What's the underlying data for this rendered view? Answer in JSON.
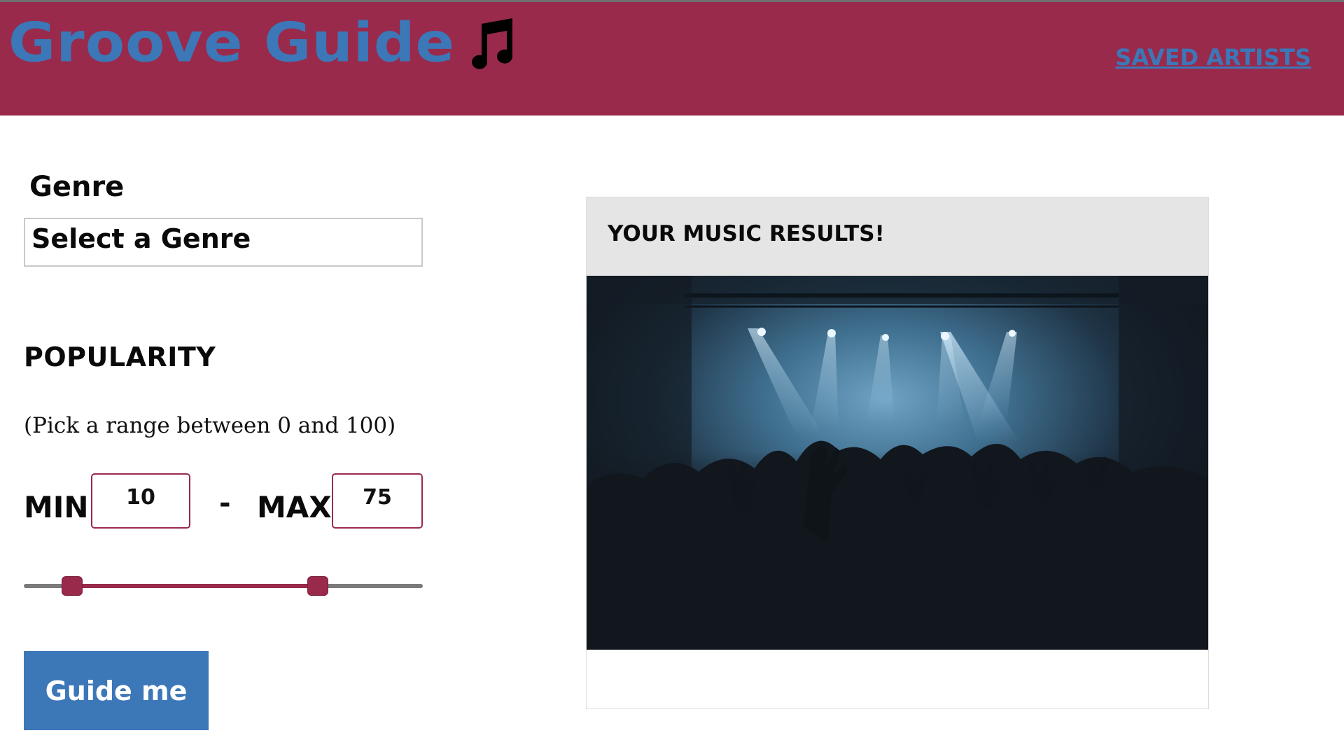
{
  "header": {
    "title": "Groove Guide",
    "logo_icon": "music-note-icon",
    "nav_link": "SAVED ARTISTS"
  },
  "form": {
    "genre_label": "Genre",
    "genre_select_value": "Select a Genre",
    "popularity_label": "POPULARITY",
    "popularity_hint": "(Pick a range between 0 and 100)",
    "min_label": "MIN",
    "separator": "-",
    "max_label": "MAX",
    "min_value": "10",
    "max_value": "75",
    "range": {
      "min": 0,
      "max": 100,
      "low": 10,
      "high": 75
    },
    "submit_label": "Guide me"
  },
  "results": {
    "title": "Your Music Results!",
    "image_alt": "concert-crowd-image"
  },
  "colors": {
    "header_bg": "#992a4b",
    "brand_blue": "#3c77b8",
    "card_header_bg": "#e5e5e5",
    "slider_track": "#7b7b7b"
  }
}
